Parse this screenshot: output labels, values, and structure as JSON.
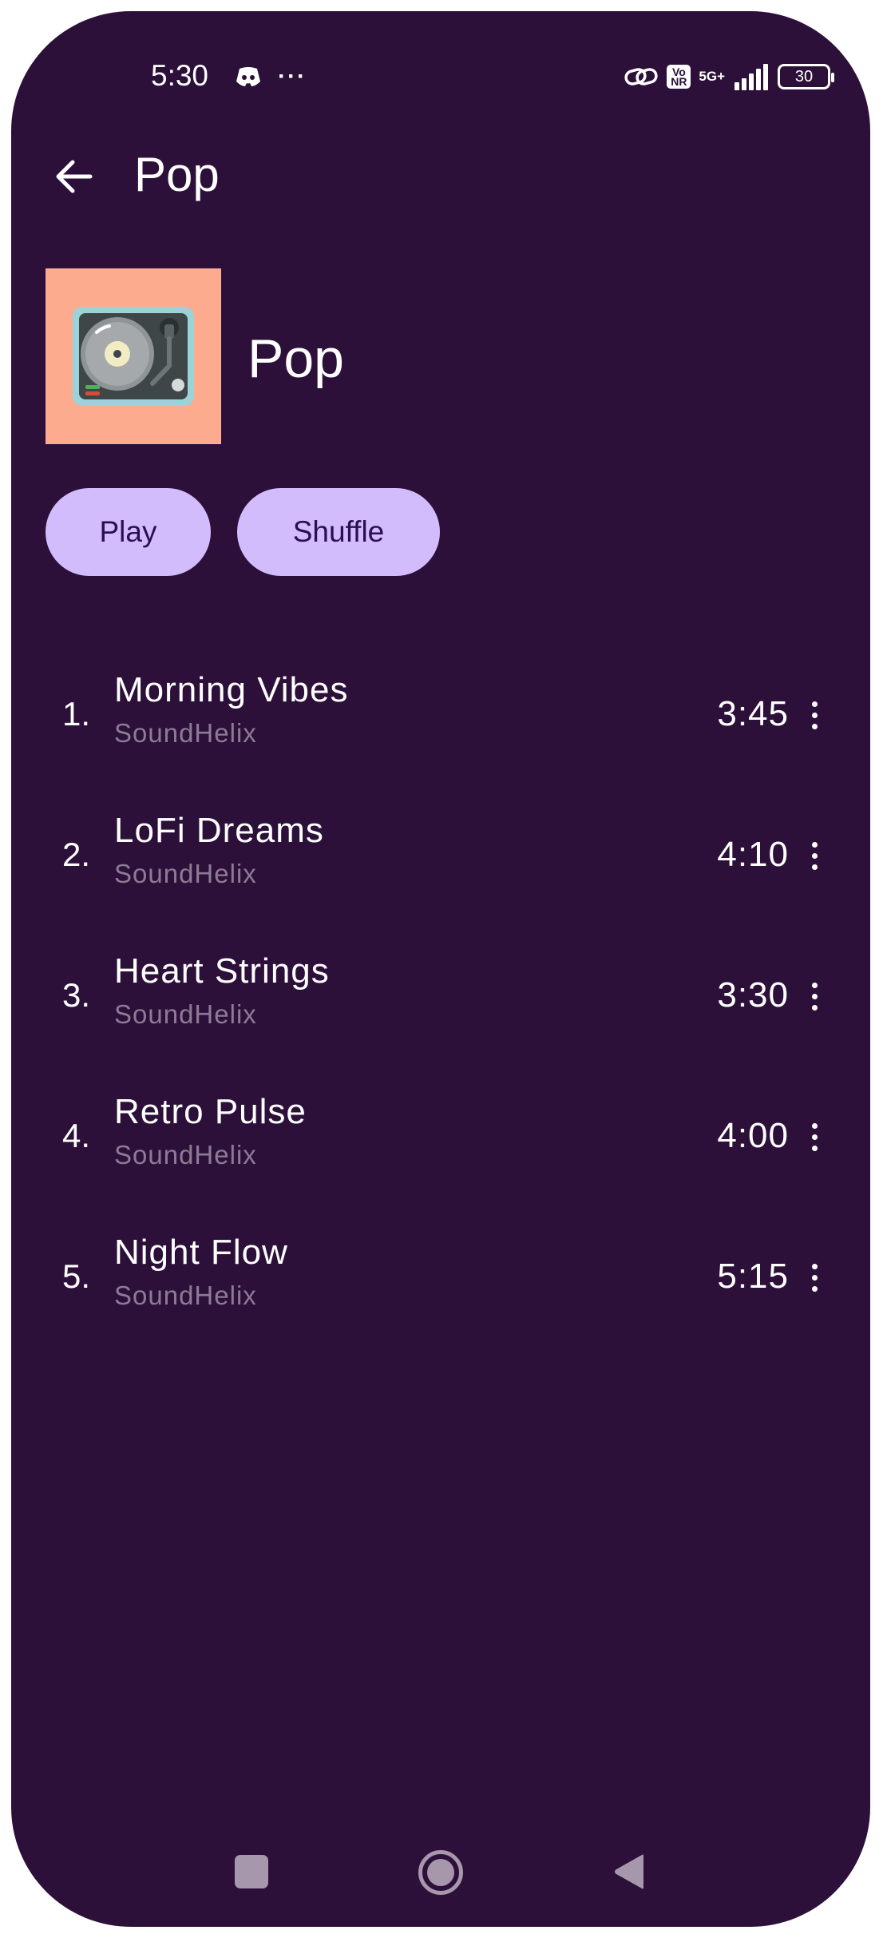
{
  "status_bar": {
    "time": "5:30",
    "more_dots": "···",
    "volte_label": "Vo NR",
    "network_label": "5G+",
    "battery_level": "30"
  },
  "app_bar": {
    "title": "Pop"
  },
  "header": {
    "playlist_name": "Pop",
    "cover_bg_color": "#fdab8e"
  },
  "actions": {
    "play_label": "Play",
    "shuffle_label": "Shuffle"
  },
  "tracks": [
    {
      "number": "1.",
      "title": "Morning Vibes",
      "artist": "SoundHelix",
      "duration": "3:45"
    },
    {
      "number": "2.",
      "title": "LoFi Dreams",
      "artist": "SoundHelix",
      "duration": "4:10"
    },
    {
      "number": "3.",
      "title": "Heart Strings",
      "artist": "SoundHelix",
      "duration": "3:30"
    },
    {
      "number": "4.",
      "title": "Retro Pulse",
      "artist": "SoundHelix",
      "duration": "4:00"
    },
    {
      "number": "5.",
      "title": "Night Flow",
      "artist": "SoundHelix",
      "duration": "5:15"
    }
  ],
  "colors": {
    "background": "#2c1039",
    "button_bg": "#d3bcfb",
    "button_text": "#2a0f54",
    "secondary_text": "#8d7b96"
  },
  "icons": {
    "back": "arrow-left-icon",
    "cover": "turntable-icon",
    "more": "more-vert-icon"
  }
}
